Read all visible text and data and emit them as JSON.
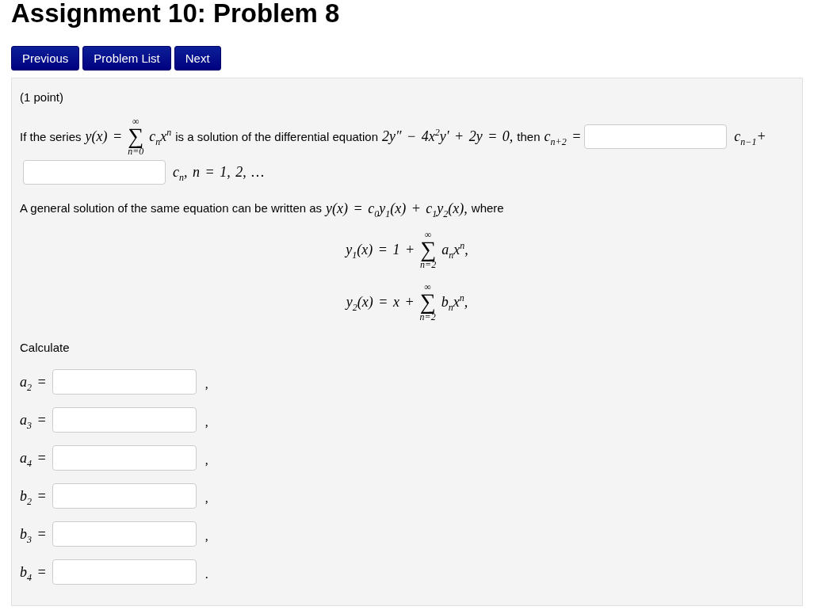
{
  "page_title": "Assignment 10: Problem 8",
  "nav_buttons": [
    {
      "label": "Previous"
    },
    {
      "label": "Problem List"
    },
    {
      "label": "Next"
    }
  ],
  "problem": {
    "points": "(1 point)",
    "statement": [
      {
        "kind": "prose",
        "text": "If the series"
      },
      {
        "kind": "math",
        "text": "y(x) ="
      },
      {
        "kind": "sum",
        "sign": "∑",
        "upper": "∞",
        "lower": "n=0"
      },
      {
        "kind": "math",
        "text": "c$_{n}$x$^{n}$"
      },
      {
        "kind": "prose",
        "text": "is a solution of the differential equation"
      },
      {
        "kind": "math",
        "text": "2y″ − 4x$^{2}$y′ + 2y = 0,"
      },
      {
        "kind": "prose",
        "text": "then"
      },
      {
        "kind": "math",
        "text": "c$_{n+2}$ ="
      },
      {
        "kind": "blank"
      },
      {
        "kind": "math",
        "text": "c$_{n−1}$+"
      },
      {
        "kind": "blank"
      },
      {
        "kind": "math",
        "text": "c$_{n}$, n = 1, 2, …"
      }
    ],
    "general_solution": [
      {
        "kind": "prose",
        "text": "A general solution of the same equation can be written as"
      },
      {
        "kind": "math",
        "text": "y(x) = c$_{0}$y$_{1}$(x) + c$_{1}$y$_{2}$(x),"
      },
      {
        "kind": "prose",
        "text": "where"
      }
    ],
    "equations": [
      [
        {
          "kind": "math",
          "text": "y$_{1}$(x) = 1 +"
        },
        {
          "kind": "sum",
          "sign": "∑",
          "upper": "∞",
          "lower": "n=2"
        },
        {
          "kind": "math",
          "text": "a$_{n}$x$^{n}$,"
        }
      ],
      [
        {
          "kind": "math",
          "text": "y$_{2}$(x) = x +"
        },
        {
          "kind": "sum",
          "sign": "∑",
          "upper": "∞",
          "lower": "n=2"
        },
        {
          "kind": "math",
          "text": "b$_{n}$x$^{n}$,"
        }
      ]
    ],
    "instruction": "Calculate",
    "answers": [
      {
        "label": "a$_{2}$ =",
        "punctuation": ","
      },
      {
        "label": "a$_{3}$ =",
        "punctuation": ","
      },
      {
        "label": "a$_{4}$ =",
        "punctuation": ","
      },
      {
        "label": "b$_{2}$ =",
        "punctuation": ","
      },
      {
        "label": "b$_{3}$ =",
        "punctuation": ","
      },
      {
        "label": "b$_{4}$ =",
        "punctuation": "."
      }
    ]
  }
}
